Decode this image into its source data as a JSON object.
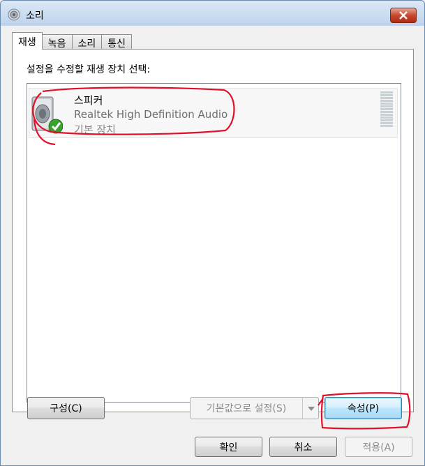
{
  "window": {
    "title": "소리",
    "icon": "speaker-app-icon"
  },
  "tabs": [
    {
      "label": "재생",
      "active": true
    },
    {
      "label": "녹음",
      "active": false
    },
    {
      "label": "소리",
      "active": false
    },
    {
      "label": "통신",
      "active": false
    }
  ],
  "panel": {
    "prompt": "설정을 수정할 재생 장치 선택:",
    "devices": [
      {
        "name": "스피커",
        "driver": "Realtek High Definition Audio",
        "status": "기본 장치",
        "icon": "speaker-icon",
        "badge": "default-check-icon"
      }
    ]
  },
  "buttons": {
    "configure": "구성(C)",
    "set_default": "기본값으로 설정(S)",
    "properties": "속성(P)",
    "ok": "확인",
    "cancel": "취소",
    "apply": "적용(A)"
  },
  "colors": {
    "annotation": "#e0102a",
    "default_button_border": "#3c7fb1",
    "check_green": "#3aa12f"
  }
}
